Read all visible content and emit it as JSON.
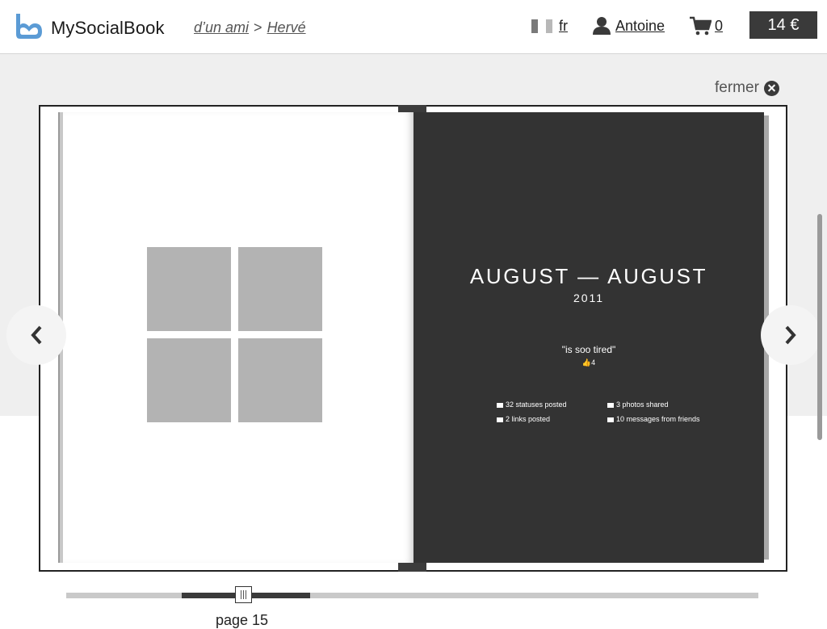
{
  "header": {
    "brand": "MySocialBook",
    "breadcrumb": [
      "d’un ami",
      "Hervé"
    ],
    "breadcrumb_separator": ">",
    "language": "fr",
    "user": "Antoine",
    "cart_count": "0",
    "price": "14 €"
  },
  "viewer": {
    "close_label": "fermer",
    "right_page": {
      "title": "AUGUST — AUGUST",
      "year": "2011",
      "quote": "\"is soo tired\"",
      "likes": "4",
      "stats": [
        {
          "icon": "status-icon",
          "label": "32 statuses posted"
        },
        {
          "icon": "photo-icon",
          "label": "3 photos shared"
        },
        {
          "icon": "link-icon",
          "label": "2 links posted"
        },
        {
          "icon": "message-icon",
          "label": "10 messages from friends"
        }
      ]
    },
    "left_page": {
      "photos": [
        "photo-placeholder",
        "photo-placeholder",
        "photo-placeholder",
        "photo-placeholder"
      ]
    }
  },
  "slider": {
    "page_label": "page 15"
  },
  "colors": {
    "accent_logo": "#5b9bd5",
    "dark": "#333333",
    "placeholder": "#b3b3b3"
  }
}
